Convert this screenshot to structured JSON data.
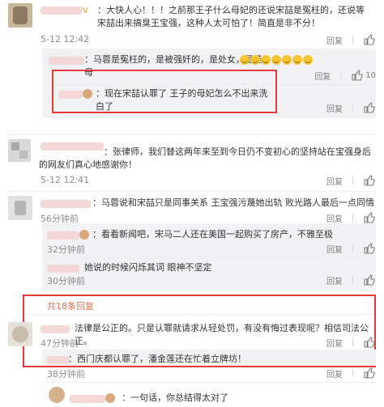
{
  "actions": {
    "reply_label": "回复",
    "like_count": "10"
  },
  "comments": [
    {
      "text": "：大快人心！！！之前那王子什么母妃的还说宋喆是冤枉的，还说等宋喆出来搞臭王宝强，这种人太可怕了！简直是非不分！",
      "time": "5-12 12:42",
      "replies": [
        {
          "text": "：马蓉是冤枉的，是被强奸的，是处女，是圣母"
        },
        {
          "text": "：现在宋喆认罪了 王子的母妃怎么不出来洗白了"
        }
      ]
    },
    {
      "text": "：张律师，我们替这两年来至到今日仍不变初心的坚持站在宝强身后的网友们真心地感谢你！",
      "time": "5-12 12:41"
    },
    {
      "text": "：马蓉说和宋喆只是同事关系 王宝强污蔑她出轨 败光路人最后一点同情",
      "time": "56分钟前",
      "replies": [
        {
          "text": "：看看新闻吧，宋马二人还在美国一起购买了房产，不雅至极",
          "time": "32分钟前"
        },
        {
          "text": "她说的时候闪烁其词 眼神不坚定",
          "time": "30分钟前"
        }
      ],
      "more": "共18条回复"
    },
    {
      "text": "法律是公正的。只是认罪就请求从轻处罚，有没有悔过表现呢？相信司法公正。",
      "time": "47分钟前",
      "replies": [
        {
          "text": "：西门庆都认罪了，潘金莲还在忙着立牌坊！",
          "time": "38分钟前"
        }
      ]
    },
    {
      "text": "：一句话，你总结得太对了"
    }
  ]
}
